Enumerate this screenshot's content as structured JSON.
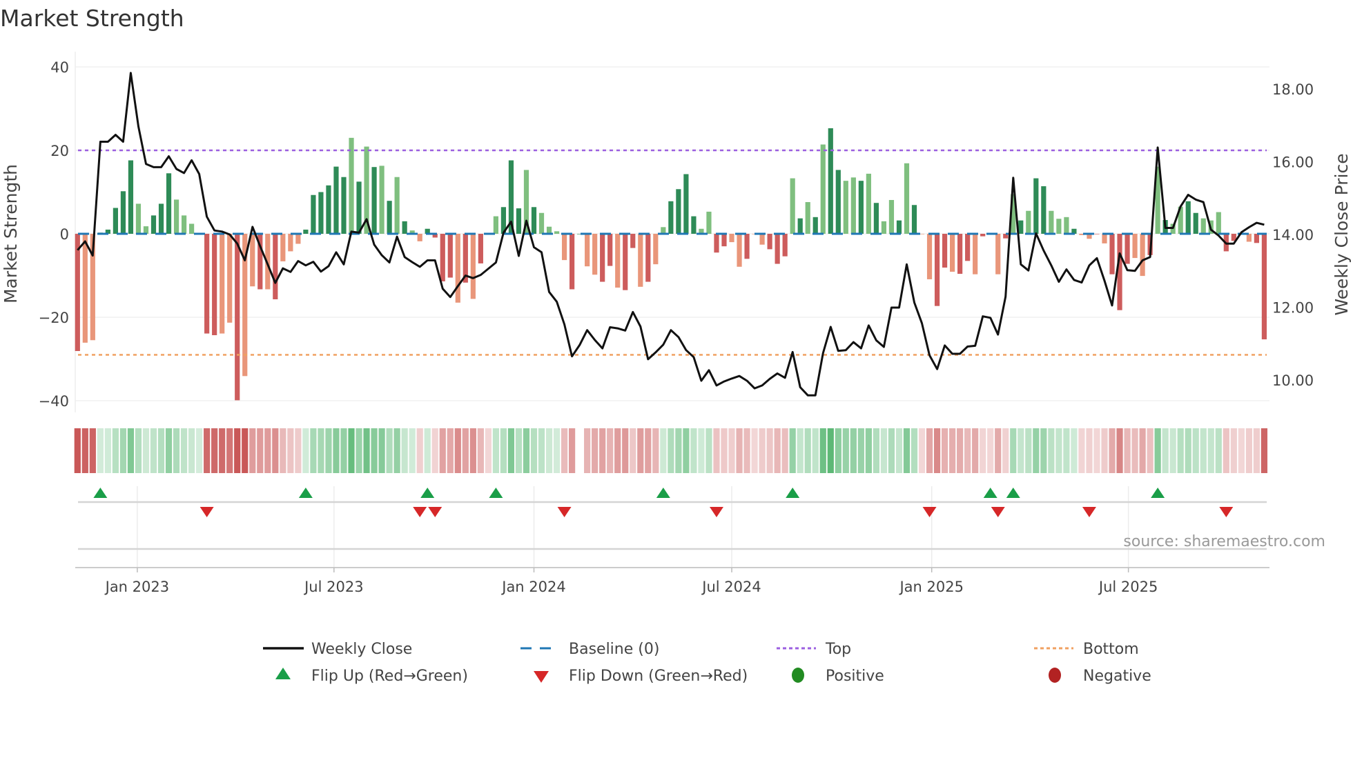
{
  "chart_data": {
    "type": "bar",
    "title": "Market Strength",
    "start_date": "2022-11-07",
    "interval": "weekly",
    "series": [
      {
        "name": "Market Strength",
        "axis": "left",
        "values": [
          -28.1,
          -26.1,
          -25.5,
          0.3,
          1.0,
          6.2,
          10.2,
          17.6,
          7.2,
          1.8,
          4.4,
          7.2,
          14.5,
          8.2,
          4.4,
          2.4,
          0.1,
          -23.9,
          -24.3,
          -23.9,
          -21.3,
          -39.9,
          -34.1,
          -12.6,
          -13.3,
          -13.3,
          -15.7,
          -6.6,
          -4.2,
          -2.4,
          1.0,
          9.3,
          10.0,
          11.6,
          16.1,
          13.6,
          23.0,
          12.5,
          20.9,
          16.0,
          16.3,
          7.9,
          13.6,
          3.0,
          0.8,
          -1.8,
          1.2,
          -0.9,
          -11.4,
          -10.5,
          -16.5,
          -11.7,
          -15.6,
          -7.1,
          -0.1,
          4.2,
          6.4,
          17.6,
          6.1,
          15.3,
          6.4,
          5.0,
          1.7,
          0.6,
          -6.3,
          -13.3,
          0,
          -7.8,
          -9.8,
          -11.5,
          -7.7,
          -12.9,
          -13.5,
          -3.4,
          -12.7,
          -11.5,
          -7.3,
          1.6,
          7.8,
          10.7,
          14.3,
          4.2,
          1.2,
          5.3,
          -4.5,
          -3.0,
          -2.0,
          -7.9,
          -6.0,
          -0.1,
          -2.6,
          -3.7,
          -7.2,
          -5.4,
          13.3,
          3.7,
          7.6,
          4.0,
          21.4,
          25.3,
          15.3,
          12.7,
          13.5,
          12.7,
          14.4,
          7.4,
          3.0,
          8.1,
          3.2,
          16.9,
          6.9,
          -0.1,
          -10.9,
          -17.3,
          -8.1,
          -9.1,
          -9.6,
          -6.5,
          -9.7,
          -0.6,
          -0.1,
          -9.7,
          -1.1,
          9.5,
          3.2,
          5.5,
          13.3,
          11.4,
          5.5,
          3.6,
          4.0,
          1.2,
          -0.3,
          -1.2,
          -0.1,
          -2.3,
          -9.7,
          -18.3,
          -7.2,
          -5.8,
          -10.1,
          -5.1,
          16.1,
          3.3,
          2.4,
          6.5,
          7.8,
          5.0,
          3.7,
          3.2,
          5.2,
          -4.2,
          -1.7,
          -0.1,
          -1.9,
          -2.2,
          -25.3
        ],
        "shade": "dlllddddlldddllllddlldlldldlllddddddldldldldllddddldldlldddldllllddlldd lddldllddddllddlldlldddldldldd lldldlldldllddlddldlldldlddllldlldldddlldldllddlllddllddd"
      },
      {
        "name": "Weekly Close",
        "axis": "right",
        "values": [
          13.57,
          13.81,
          13.42,
          16.55,
          16.55,
          16.74,
          16.55,
          18.44,
          16.97,
          15.94,
          15.85,
          15.85,
          16.15,
          15.8,
          15.69,
          16.04,
          15.66,
          14.49,
          14.11,
          14.08,
          14.0,
          13.75,
          13.29,
          14.21,
          13.68,
          13.18,
          12.67,
          13.07,
          12.97,
          13.27,
          13.15,
          13.25,
          12.98,
          13.13,
          13.51,
          13.18,
          14.08,
          14.05,
          14.42,
          13.72,
          13.43,
          13.23,
          13.94,
          13.38,
          13.24,
          13.11,
          13.29,
          13.29,
          12.51,
          12.28,
          12.58,
          12.87,
          12.8,
          12.89,
          13.06,
          13.23,
          14.05,
          14.35,
          13.41,
          14.38,
          13.65,
          13.51,
          12.42,
          12.15,
          11.53,
          10.65,
          10.96,
          11.37,
          11.1,
          10.87,
          11.45,
          11.42,
          11.36,
          11.87,
          11.47,
          10.57,
          10.76,
          10.97,
          11.37,
          11.18,
          10.82,
          10.63,
          9.98,
          10.27,
          9.85,
          9.96,
          10.04,
          10.11,
          9.98,
          9.77,
          9.85,
          10.03,
          10.18,
          10.06,
          10.77,
          9.8,
          9.58,
          9.58,
          10.74,
          11.46,
          10.8,
          10.82,
          11.04,
          10.87,
          11.5,
          11.09,
          10.91,
          11.99,
          11.99,
          13.18,
          12.13,
          11.56,
          10.68,
          10.3,
          10.95,
          10.72,
          10.72,
          10.92,
          10.94,
          11.75,
          11.71,
          11.25,
          12.29,
          15.56,
          13.18,
          13.01,
          14.03,
          13.56,
          13.15,
          12.7,
          13.04,
          12.75,
          12.68,
          13.15,
          13.35,
          12.73,
          12.05,
          13.48,
          13.02,
          13.0,
          13.29,
          13.38,
          16.39,
          14.18,
          14.18,
          14.77,
          15.09,
          14.96,
          14.89,
          14.13,
          13.97,
          13.75,
          13.75,
          14.06,
          14.2,
          14.32,
          14.27
        ]
      }
    ],
    "y_left": {
      "label": "Market Strength",
      "range": [
        -42,
        42
      ],
      "ticks": [
        40,
        20,
        0,
        -20,
        -40
      ],
      "tick_labels": [
        "40",
        "20",
        "0",
        "−20",
        "−40"
      ]
    },
    "y_right": {
      "label": "Weekly Close Price",
      "ticks": [
        18,
        16,
        14,
        12,
        10
      ],
      "tick_labels": [
        "18.00",
        "16.00",
        "14.00",
        "12.00",
        "10.00"
      ]
    },
    "x_ticks": [
      {
        "date": "2023-01-01",
        "label": "Jan 2023"
      },
      {
        "date": "2023-07-01",
        "label": "Jul 2023"
      },
      {
        "date": "2024-01-01",
        "label": "Jan 2024"
      },
      {
        "date": "2024-07-01",
        "label": "Jul 2024"
      },
      {
        "date": "2025-01-01",
        "label": "Jan 2025"
      },
      {
        "date": "2025-07-01",
        "label": "Jul 2025"
      }
    ],
    "reference_lines": {
      "top": 20,
      "bottom": -29,
      "baseline": 0
    },
    "flip_up": [
      "2022-11-28",
      "2023-06-05",
      "2023-09-25",
      "2023-11-27",
      "2024-04-29",
      "2024-08-26",
      "2025-02-24",
      "2025-03-17",
      "2025-07-28"
    ],
    "flip_down": [
      "2023-03-06",
      "2023-09-18",
      "2023-10-02",
      "2024-01-29",
      "2024-06-17",
      "2024-12-30",
      "2025-03-03",
      "2025-05-26",
      "2025-09-29"
    ],
    "grid": true,
    "legend_position": "bottom",
    "legend": [
      {
        "key": "close",
        "label": "Weekly Close"
      },
      {
        "key": "baseline",
        "label": "Baseline (0)"
      },
      {
        "key": "top",
        "label": "Top"
      },
      {
        "key": "bottom",
        "label": "Bottom"
      },
      {
        "key": "flip_up",
        "label": "Flip Up (Red→Green)"
      },
      {
        "key": "flip_down",
        "label": "Flip Down (Green→Red)"
      },
      {
        "key": "positive",
        "label": "Positive"
      },
      {
        "key": "negative",
        "label": "Negative"
      }
    ],
    "source": "source: sharemaestro.com"
  },
  "colors": {
    "pos_dark": "#2e8b57",
    "pos_light": "#7fbf7f",
    "neg_dark": "#cd5c5c",
    "neg_light": "#e9967a",
    "close": "#111111",
    "baseline": "#1f77b4",
    "top": "#9b5fe0",
    "bottom": "#f0a060",
    "flip_up": "#1a9e48",
    "flip_down": "#d62728",
    "positive": "#228b22",
    "negative": "#b22222"
  }
}
